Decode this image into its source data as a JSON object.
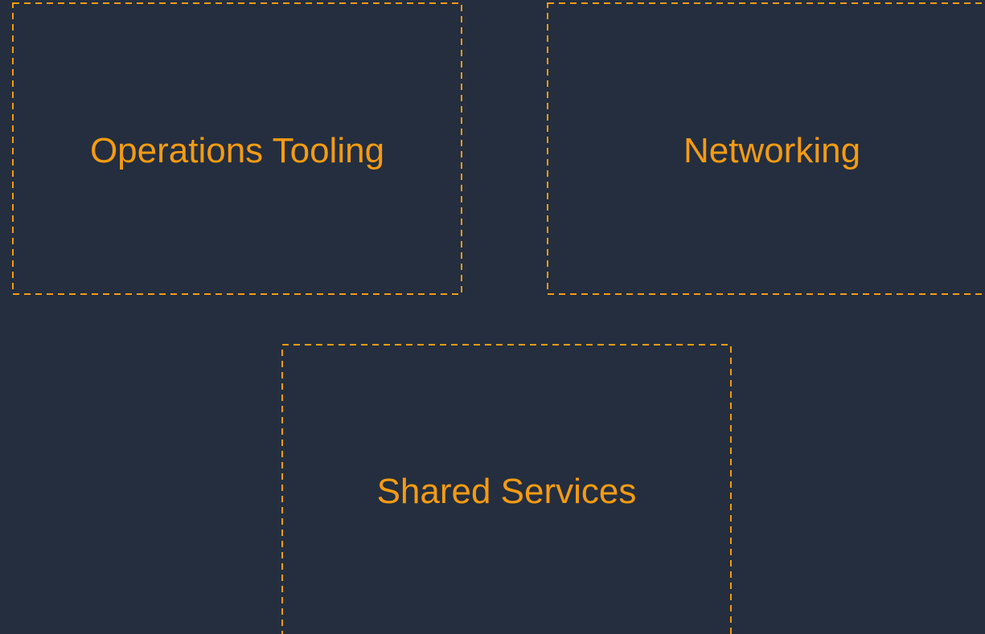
{
  "colors": {
    "background": "#242e3e",
    "accent": "#f59b12"
  },
  "diagram": {
    "boxes": [
      {
        "label": "Operations Tooling"
      },
      {
        "label": "Networking"
      },
      {
        "label": "Shared Services"
      }
    ]
  }
}
